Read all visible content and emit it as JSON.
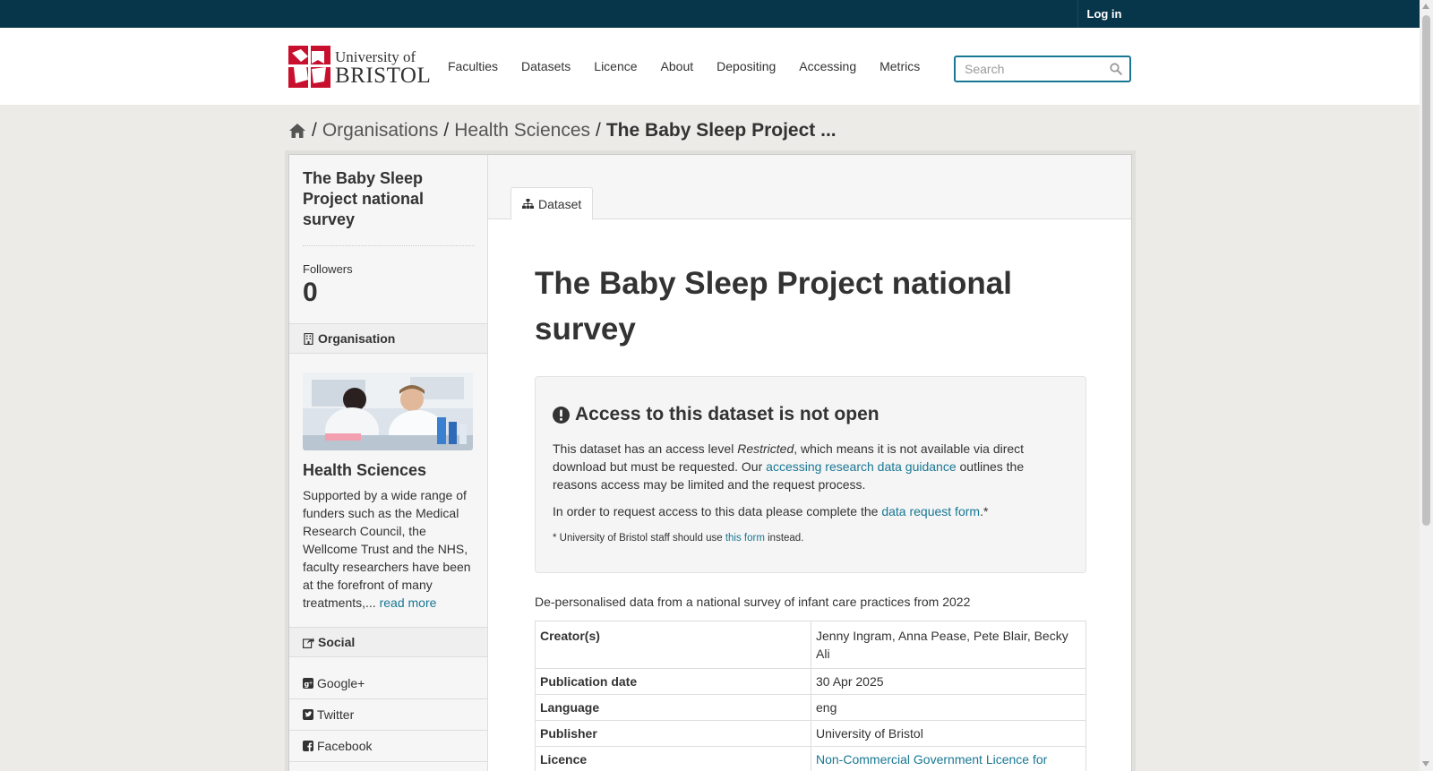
{
  "account": {
    "login_label": "Log in"
  },
  "header": {
    "logo_line1": "University of",
    "logo_line2": "BRISTOL",
    "nav": [
      "Faculties",
      "Datasets",
      "Licence",
      "About",
      "Depositing",
      "Accessing",
      "Metrics"
    ],
    "search_placeholder": "Search"
  },
  "breadcrumb": {
    "sep": "/",
    "items": [
      "Organisations",
      "Health Sciences"
    ],
    "active": "The Baby Sleep Project ..."
  },
  "aside": {
    "title": "The Baby Sleep Project national survey",
    "followers_label": "Followers",
    "followers_count": "0",
    "organisation_heading": "Organisation",
    "org_name": "Health Sciences",
    "org_description": "Supported by a wide range of funders such as the Medical Research Council, the Wellcome Trust and the NHS, faculty researchers have been at the forefront of many treatments,...",
    "read_more": "read more",
    "social_heading": "Social",
    "social": [
      "Google+",
      "Twitter",
      "Facebook"
    ]
  },
  "primary": {
    "tab_label": "Dataset",
    "title": "The Baby Sleep Project national survey",
    "alert": {
      "heading": "Access to this dataset is not open",
      "p1_a": "This dataset has an access level ",
      "p1_em": "Restricted",
      "p1_b": ", which means it is not available via direct download but must be requested. Our ",
      "p1_link": "accessing research data guidance",
      "p1_c": " outlines the reasons access may be limited and the request process.",
      "p2_a": "In order to request access to this data please complete the ",
      "p2_link": "data request form",
      "p2_b": ".*",
      "note_a": "* University of Bristol staff should use ",
      "note_link": "this form",
      "note_b": " instead."
    },
    "notes": "De-personalised data from a national survey of infant care practices from 2022",
    "table": [
      {
        "label": "Creator(s)",
        "value": "Jenny Ingram, Anna Pease, Pete Blair, Becky Ali"
      },
      {
        "label": "Publication date",
        "value": "30 Apr 2025"
      },
      {
        "label": "Language",
        "value": "eng"
      },
      {
        "label": "Publisher",
        "value": "University of Bristol"
      },
      {
        "label": "Licence",
        "value": "Non-Commercial Government Licence for public sector information"
      }
    ]
  },
  "colors": {
    "masthead": "#07364a",
    "link": "#187794",
    "page_bg": "#edebe8",
    "brand_red": "#c8102e"
  }
}
